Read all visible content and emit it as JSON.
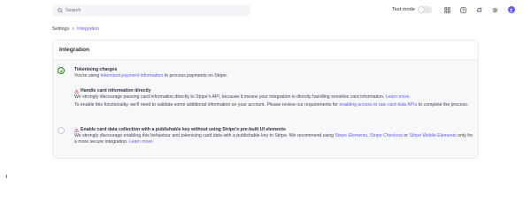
{
  "search": {
    "placeholder": "Search"
  },
  "topbar": {
    "test_mode_label": "Test mode",
    "icons": [
      "apps-grid-icon",
      "help-icon",
      "notifications-bell-icon",
      "settings-gear-icon",
      "account-avatar"
    ],
    "accent": "#635bff"
  },
  "breadcrumb": {
    "root": "Settings",
    "separator": ">",
    "current": "Integration"
  },
  "card": {
    "title": "Integration",
    "options": [
      {
        "title": "Tokenising charges",
        "desc_pre": "You're using ",
        "desc_link": "tokenized payment information",
        "desc_post": " to process payments on Stripe."
      },
      {
        "title": "Handle card information directly",
        "desc_pre": "We strongly discourage passing card information directly to Stripe's API, because it means your integration is directly handling sensitive card information. ",
        "desc_link": "Learn more.",
        "desc2_pre": "To enable this functionality, we'll need to validate some additional information on your account. Please review our requirements for ",
        "desc2_link": "enabling access to raw card data APIs",
        "desc2_post": " to complete the process."
      },
      {
        "title": "Enable card data collection with a publishable key without using Stripe's pre-built UI elements",
        "desc_pre": "We strongly discourage enabling this behaviour and tokenising card data with a publishable key to Stripe. We recommend using ",
        "link_a": "Stripe Elements",
        "sep_a": ", ",
        "link_b": "Stripe Checkout",
        "sep_b": " or ",
        "link_c": "Stripe Mobile Elements",
        "desc_mid": " only for a more secure integration. ",
        "link_d": "Learn more."
      }
    ]
  },
  "colors": {
    "success": "#228403",
    "warning": "#df1b41",
    "link": "#635bff"
  }
}
